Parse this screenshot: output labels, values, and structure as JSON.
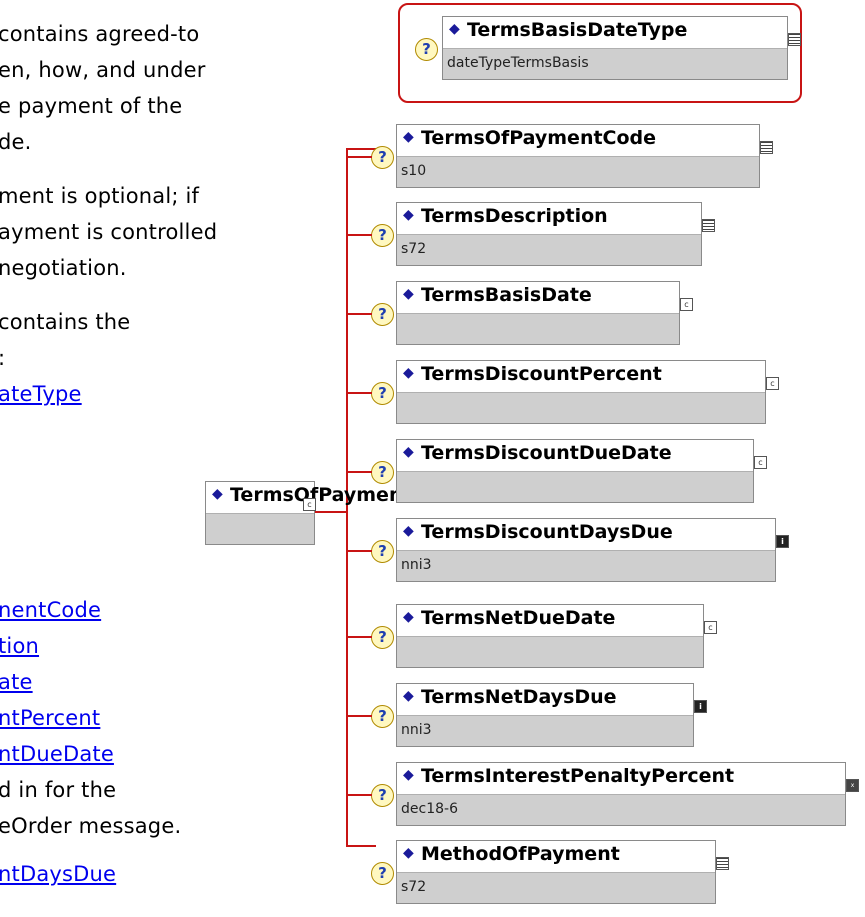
{
  "left_text": [
    "contains agreed-to",
    "en, how, and under",
    "e payment of the",
    "de.",
    "ment is optional; if",
    "ayment is controlled",
    "negotiation.",
    "contains the",
    ":",
    "ateType",
    "nentCode",
    "tion",
    "ate",
    "ntPercent",
    "ntDueDate",
    "d in for the",
    "eOrder message.",
    "ntDaysDue"
  ],
  "root": {
    "name": "TermsOfPayment"
  },
  "children": [
    {
      "name": "TermsBasisDateType",
      "type": "dateTypeTermsBasis",
      "selected": true,
      "icon": "list-icon"
    },
    {
      "name": "TermsOfPaymentCode",
      "type": "s10",
      "icon": "list-icon"
    },
    {
      "name": "TermsDescription",
      "type": "s72",
      "icon": "list-icon"
    },
    {
      "name": "TermsBasisDate",
      "type": "",
      "icon": "complex-type-icon"
    },
    {
      "name": "TermsDiscountPercent",
      "type": "",
      "icon": "complex-type-icon"
    },
    {
      "name": "TermsDiscountDueDate",
      "type": "",
      "icon": "complex-type-icon"
    },
    {
      "name": "TermsDiscountDaysDue",
      "type": "nni3",
      "icon": "info-icon"
    },
    {
      "name": "TermsNetDueDate",
      "type": "",
      "icon": "complex-type-icon"
    },
    {
      "name": "TermsNetDaysDue",
      "type": "nni3",
      "icon": "info-icon"
    },
    {
      "name": "TermsInterestPenaltyPercent",
      "type": "dec18-6",
      "icon": "xs-type-icon"
    },
    {
      "name": "MethodOfPayment",
      "type": "s72",
      "icon": "list-icon"
    }
  ],
  "colors": {
    "connector": "#c81414",
    "link": "#0000ee",
    "selection": "#c81414"
  },
  "help_glyph": "?",
  "bullet_glyph": "◆"
}
